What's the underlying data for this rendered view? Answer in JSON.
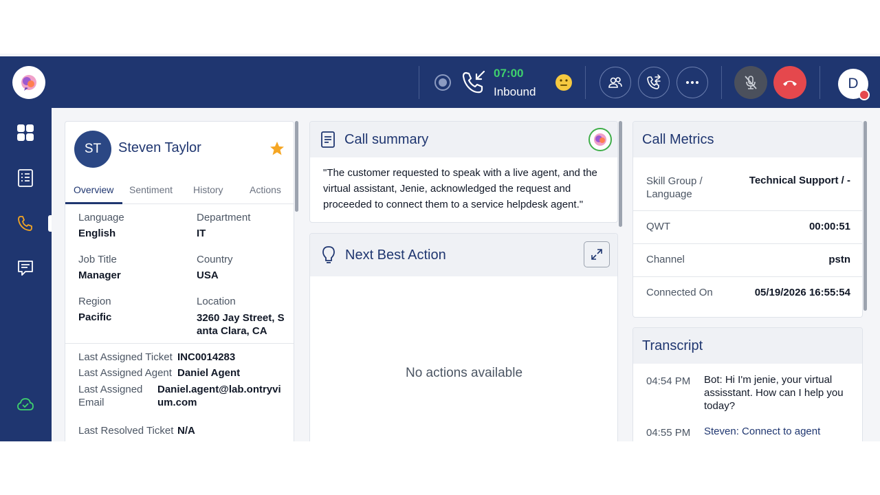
{
  "header": {
    "timer": "07:00",
    "direction": "Inbound",
    "user_initial": "D"
  },
  "contact": {
    "initials": "ST",
    "name": "Steven Taylor",
    "tabs": [
      "Overview",
      "Sentiment",
      "History",
      "Actions"
    ],
    "fields": [
      {
        "label": "Language",
        "value": "English"
      },
      {
        "label": "Department",
        "value": "IT"
      },
      {
        "label": "Job Title",
        "value": "Manager"
      },
      {
        "label": "Country",
        "value": "USA"
      },
      {
        "label": "Region",
        "value": "Pacific"
      },
      {
        "label": "Location",
        "value": "3260 Jay Street, S anta Clara, CA"
      }
    ],
    "details": [
      {
        "label": "Last Assigned Ticket",
        "value": "INC0014283"
      },
      {
        "label": "Last Assigned Agent",
        "value": "Daniel Agent"
      },
      {
        "label": "Last Assigned Email",
        "value": "Daniel.agent@lab.ontryvium.com"
      },
      {
        "label": "Last Resolved Ticket",
        "value": "N/A"
      }
    ]
  },
  "summary": {
    "title": "Call summary",
    "text": "\"The customer requested to speak with a live agent, and the virtual assistant, Jenie, acknowledged the request and proceeded to connect them to a service helpdesk agent.\""
  },
  "nba": {
    "title": "Next Best Action",
    "empty": "No actions available"
  },
  "metrics": {
    "title": "Call Metrics",
    "rows": [
      {
        "label": "Skill Group / Language",
        "value": "Technical Support / -"
      },
      {
        "label": "QWT",
        "value": "00:00:51"
      },
      {
        "label": "Channel",
        "value": "pstn"
      },
      {
        "label": "Connected On",
        "value": "05/19/2026 16:55:54"
      }
    ]
  },
  "transcript": {
    "title": "Transcript",
    "entries": [
      {
        "time": "04:54 PM",
        "text": "Bot: Hi I'm jenie, your virtual assisstant. How can I help you today?"
      },
      {
        "time": "04:55 PM",
        "text": "Steven: Connect to agent"
      }
    ]
  },
  "colors": {
    "brand": "#1f3670",
    "timer": "#3fd16d",
    "hangup": "#e5484d",
    "star": "#f5a623"
  }
}
